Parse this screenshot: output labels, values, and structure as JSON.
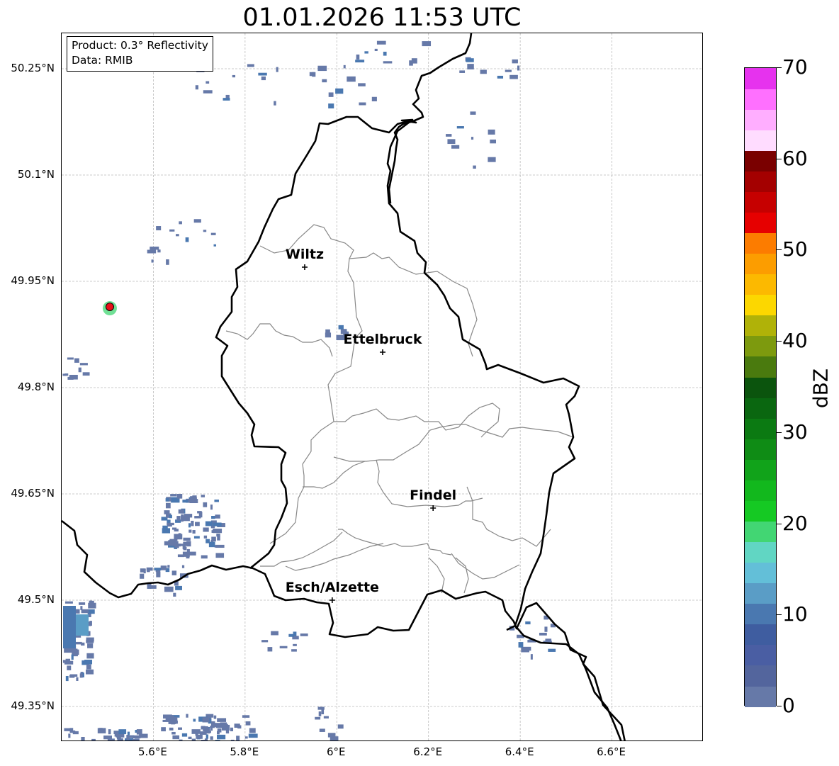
{
  "title": "01.01.2026 11:53 UTC",
  "info_box": {
    "product": "Product: 0.3° Reflectivity",
    "data_source": "Data: RMIB"
  },
  "axes": {
    "lat_ticks": [
      "50.25°N",
      "50.1°N",
      "49.95°N",
      "49.8°N",
      "49.65°N",
      "49.5°N",
      "49.35°N"
    ],
    "lon_ticks": [
      "5.6°E",
      "5.8°E",
      "6°E",
      "6.2°E",
      "6.4°E",
      "6.6°E"
    ],
    "lon_range": [
      5.4,
      6.8
    ],
    "lat_range": [
      49.3,
      50.3
    ],
    "gridlines": true
  },
  "cities": [
    {
      "name": "Wiltz",
      "lon": 5.93,
      "lat": 49.97
    },
    {
      "name": "Ettelbruck",
      "lon": 6.1,
      "lat": 49.85
    },
    {
      "name": "Findel",
      "lon": 6.21,
      "lat": 49.63
    },
    {
      "name": "Esch/Alzette",
      "lon": 5.99,
      "lat": 49.5
    }
  ],
  "radar_site": {
    "lon": 5.505,
    "lat": 49.914,
    "color": "#e8101a"
  },
  "colorbar": {
    "label": "dBZ",
    "ticks": [
      "0",
      "10",
      "20",
      "30",
      "40",
      "50",
      "60",
      "70"
    ],
    "range": [
      0,
      70
    ],
    "colors": [
      "#6679a8",
      "#53659d",
      "#4a5ea3",
      "#3f5da0",
      "#4a78b0",
      "#5a9dc6",
      "#63bfd8",
      "#61d6c3",
      "#42d673",
      "#15c923",
      "#12b81d",
      "#11a31a",
      "#0f8c15",
      "#0b7a12",
      "#0a6710",
      "#0b540d",
      "#4a7a0e",
      "#7d9a0e",
      "#b0b208",
      "#fcd700",
      "#fcb900",
      "#fc9d00",
      "#fc7c00",
      "#e60000",
      "#c60000",
      "#a40000",
      "#7a0000",
      "#ffdcff",
      "#ffaeff",
      "#ff70ff",
      "#e632ee"
    ]
  }
}
